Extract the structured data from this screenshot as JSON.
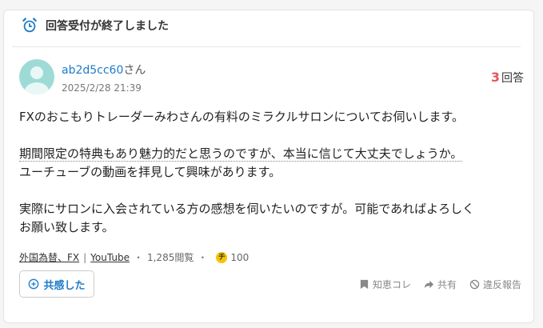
{
  "banner": {
    "title": "回答受付が終了しました",
    "icon": "alarm-clock-icon"
  },
  "question": {
    "user": "ab2d5cc60",
    "honorific": "さん",
    "date": "2025/2/28 21:39",
    "answer_count": "3",
    "answer_label": "回答",
    "body": [
      "FXのおこもりトレーダーみわさんの有料のミラクルサロンについてお伺いします。",
      "",
      "期間限定の特典もあり魅力的だと思うのですが、本当に信じて大丈夫でしょうか。",
      "ユーチューブの動画を拝見して興味があります。",
      "",
      "実際にサロンに入会されている方の感想を伺いたいのですが。可能であればよろしく",
      "お願い致します。"
    ]
  },
  "meta": {
    "category": "外国為替、FX",
    "category_sep": "|",
    "tag": "YouTube",
    "views": "1,285閲覧",
    "coin_symbol": "チ",
    "coins": "100"
  },
  "actions": {
    "empathy": "共感した",
    "bookmark": "知恵コレ",
    "share": "共有",
    "report": "違反報告"
  },
  "colors": {
    "accent": "#1f7bc9",
    "answer_count": "#e8545c",
    "avatar": "#9edbd6",
    "coin": "#f6c400"
  }
}
